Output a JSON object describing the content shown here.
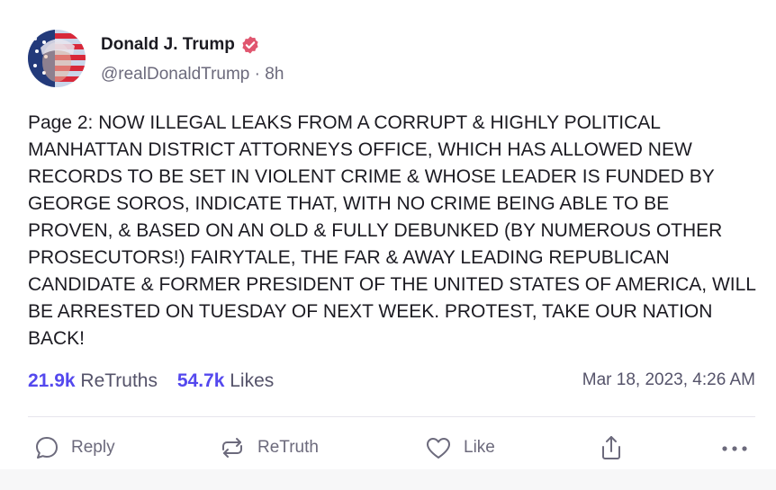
{
  "post": {
    "author": {
      "display_name": "Donald J. Trump",
      "handle": "@realDonaldTrump",
      "separator": " · ",
      "age": "8h",
      "verified_icon": "verified-badge-icon"
    },
    "body": "Page 2: NOW ILLEGAL LEAKS FROM A CORRUPT & HIGHLY POLITICAL MANHATTAN DISTRICT ATTORNEYS OFFICE, WHICH HAS ALLOWED NEW RECORDS TO BE SET IN VIOLENT CRIME & WHOSE LEADER IS FUNDED BY GEORGE SOROS, INDICATE THAT, WITH NO CRIME BEING ABLE TO BE PROVEN, & BASED ON AN OLD & FULLY DEBUNKED (BY NUMEROUS OTHER PROSECUTORS!) FAIRYTALE, THE FAR & AWAY LEADING REPUBLICAN CANDIDATE & FORMER PRESIDENT OF THE UNITED STATES OF AMERICA, WILL BE ARRESTED ON TUESDAY OF NEXT WEEK. PROTEST, TAKE OUR NATION BACK!",
    "stats": {
      "retruths_count": "21.9k",
      "retruths_label": "ReTruths",
      "likes_count": "54.7k",
      "likes_label": "Likes"
    },
    "timestamp": "Mar 18, 2023, 4:26 AM",
    "actions": {
      "reply_label": "Reply",
      "retruth_label": "ReTruth",
      "like_label": "Like"
    },
    "colors": {
      "accent": "#5448ee",
      "verified": "#e0566f",
      "muted_text": "#6c6a7c",
      "text": "#1c1b22"
    }
  }
}
